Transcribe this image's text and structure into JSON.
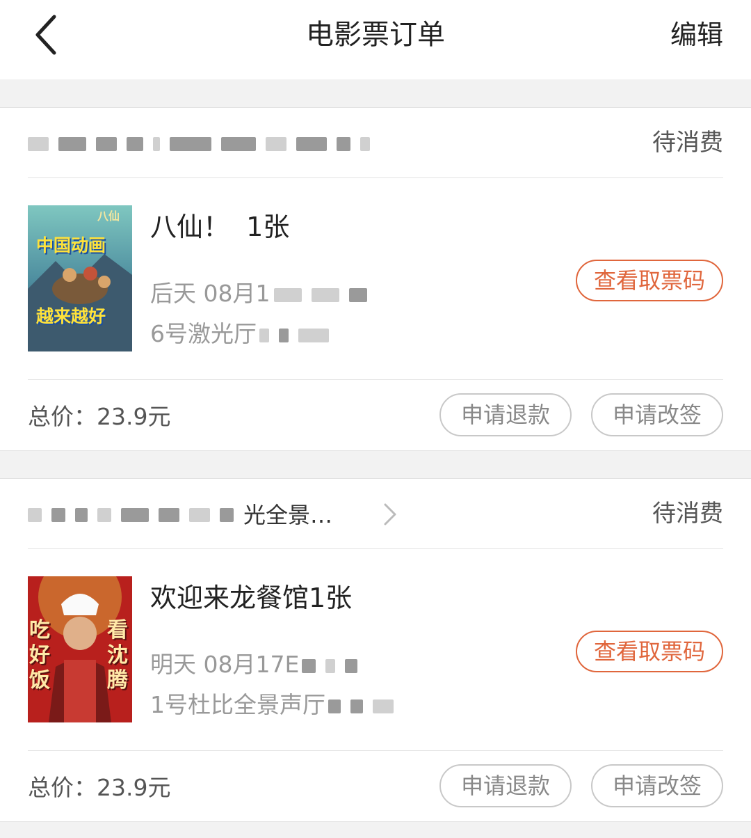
{
  "header": {
    "title": "电影票订单",
    "edit_label": "编辑"
  },
  "orders": [
    {
      "shop_name": "",
      "status": "待消费",
      "movie_title": "八仙！  1张",
      "show_time": "后天 08月1",
      "hall": "6号激光厅",
      "ticket_code_label": "查看取票码",
      "total_price": "总价：23.9元",
      "refund_label": "申请退款",
      "change_label": "申请改签",
      "poster": {
        "top_text": "中国动画",
        "bottom_text": "越来越好",
        "logo_text": "八仙"
      }
    },
    {
      "shop_name": "光全景…",
      "status": "待消费",
      "movie_title": "欢迎来龙餐馆1张",
      "show_time": "明天 08月17E",
      "hall": "1号杜比全景声厅",
      "ticket_code_label": "查看取票码",
      "total_price": "总价：23.9元",
      "refund_label": "申请退款",
      "change_label": "申请改签",
      "poster": {
        "left_text": "吃好饭",
        "right_text": "看沈腾"
      }
    }
  ],
  "colors": {
    "accent": "#e0663c",
    "background": "#f2f2f2"
  }
}
